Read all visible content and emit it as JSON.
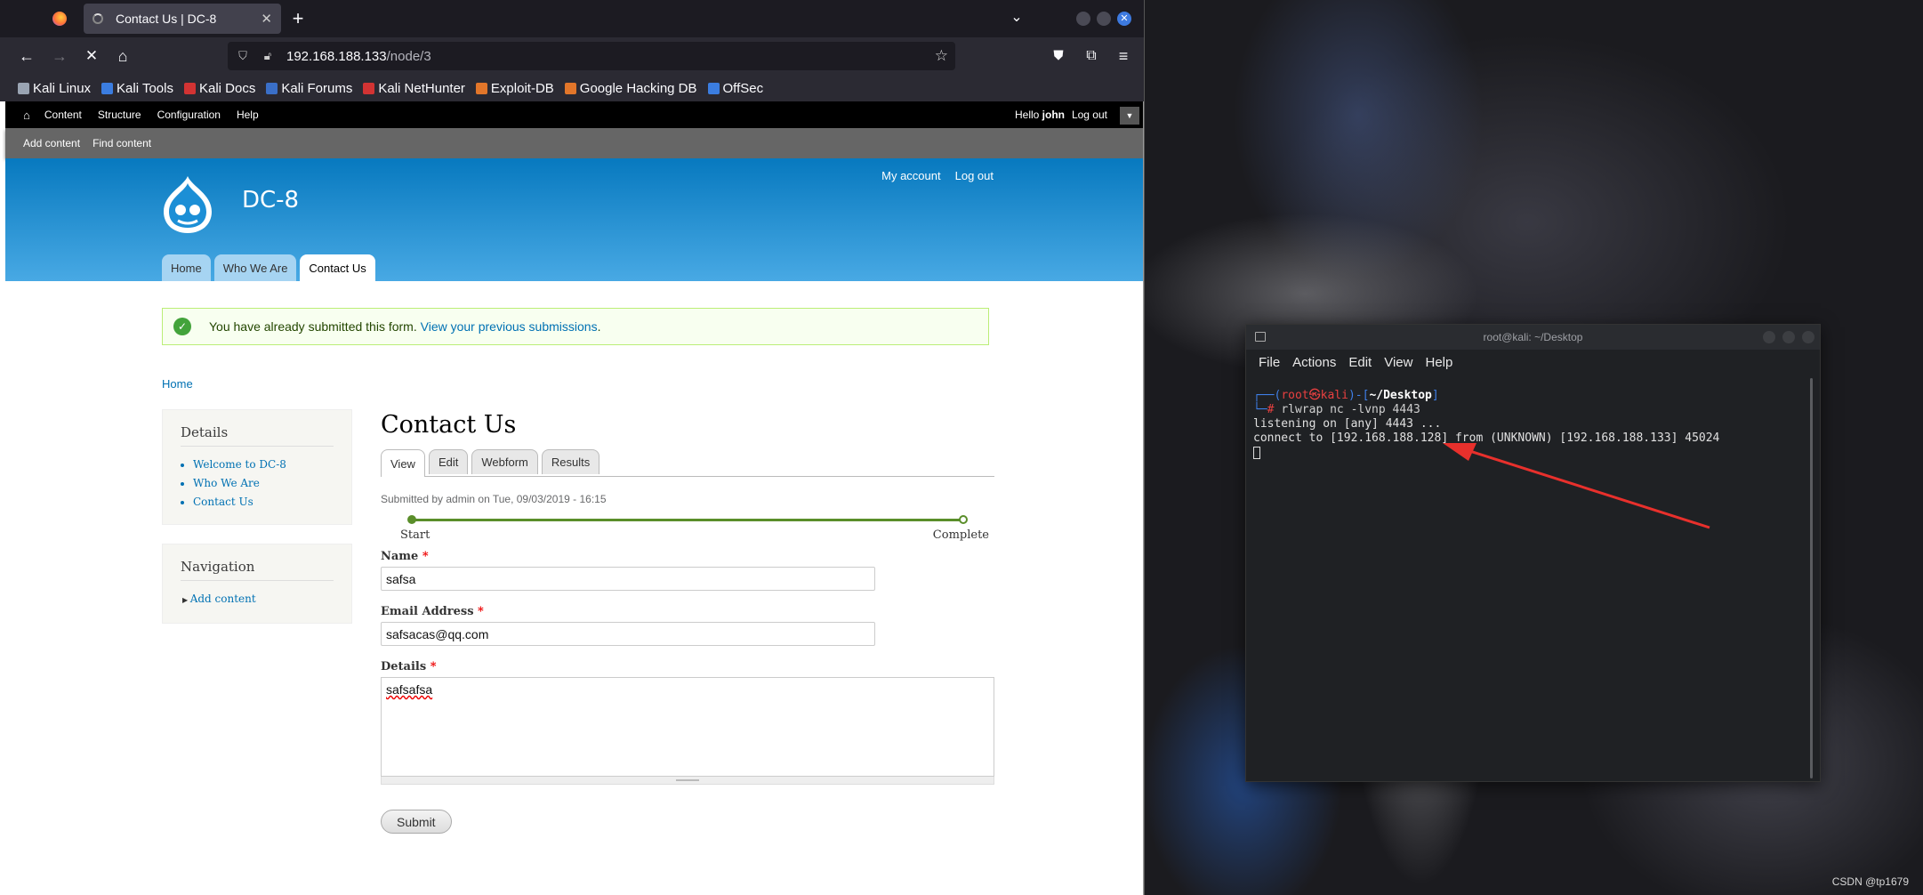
{
  "browser": {
    "tab_title": "Contact Us | DC-8",
    "url_host": "192.168.188.133",
    "url_path": "/node/3",
    "bookmarks": [
      "Kali Linux",
      "Kali Tools",
      "Kali Docs",
      "Kali Forums",
      "Kali NetHunter",
      "Exploit-DB",
      "Google Hacking DB",
      "OffSec"
    ],
    "bookmark_colors": [
      "#9aa4b3",
      "#3b7de0",
      "#d23333",
      "#3a6fc8",
      "#d23333",
      "#e2762a",
      "#e2762a",
      "#3b7de0"
    ]
  },
  "drupal": {
    "toolbar": {
      "items": [
        "Content",
        "Structure",
        "Configuration",
        "Help"
      ],
      "hello_prefix": "Hello ",
      "user": "john",
      "logout": "Log out"
    },
    "shortcuts": [
      "Add content",
      "Find content"
    ],
    "site_name": "DC-8",
    "secondary_menu": [
      "My account",
      "Log out"
    ],
    "main_menu": [
      "Home",
      "Who We Are",
      "Contact Us"
    ],
    "message": {
      "text": "You have already submitted this form. ",
      "link": "View your previous submissions",
      "suffix": "."
    },
    "breadcrumb": "Home",
    "sidebar": {
      "details_title": "Details",
      "details_items": [
        "Welcome to DC-8",
        "Who We Are",
        "Contact Us"
      ],
      "nav_title": "Navigation",
      "nav_items": [
        "Add content"
      ]
    },
    "page_title": "Contact Us",
    "local_tabs": [
      "View",
      "Edit",
      "Webform",
      "Results"
    ],
    "submitted": "Submitted by admin on Tue, 09/03/2019 - 16:15",
    "progress": {
      "start": "Start",
      "end": "Complete"
    },
    "form": {
      "name_label": "Name",
      "name_value": "safsa",
      "email_label": "Email Address",
      "email_value": "safsacas@qq.com",
      "details_label": "Details",
      "details_value": "safsafsa",
      "required_mark": "*",
      "submit": "Submit"
    }
  },
  "terminal": {
    "title": "root@kali: ~/Desktop",
    "menu": [
      "File",
      "Actions",
      "Edit",
      "View",
      "Help"
    ],
    "prompt_user": "root",
    "prompt_at": "㉿",
    "prompt_host": "kali",
    "prompt_dir": "~/Desktop",
    "command": "rlwrap nc -lvnp 4443",
    "output": [
      "listening on [any] 4443 ...",
      "connect to [192.168.188.128] from (UNKNOWN) [192.168.188.133] 45024"
    ]
  },
  "watermark": "CSDN @tp1679",
  "colors": {
    "arrow": "#e8302c",
    "drupal_blue": "#0779bf",
    "kali_prompt_blue": "#3f7fe8",
    "kali_prompt_red": "#e84040"
  }
}
